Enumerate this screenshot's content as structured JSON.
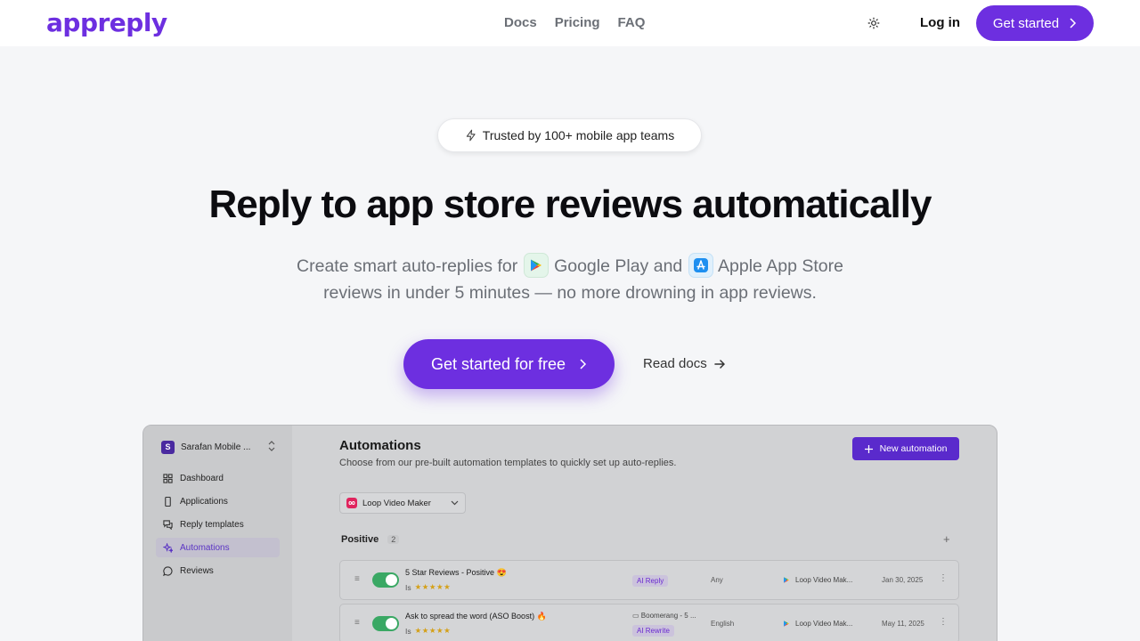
{
  "brand": {
    "logo": "appreply",
    "accent": "#6d2fe0"
  },
  "nav": {
    "links": [
      "Docs",
      "Pricing",
      "FAQ"
    ],
    "theme_icon": "sun-icon",
    "login": "Log in",
    "cta": "Get started"
  },
  "hero": {
    "badge": "Trusted by 100+ mobile app teams",
    "title": "Reply to app store reviews automatically",
    "sub_part1": "Create smart auto-replies for",
    "google_play": "Google Play",
    "and": "and",
    "apple_store": "Apple App Store",
    "sub_line2": "reviews in under 5 minutes — no more drowning in app reviews.",
    "cta": "Get started for free",
    "docs": "Read docs"
  },
  "preview": {
    "workspace": {
      "initial": "S",
      "name": "Sarafan Mobile ..."
    },
    "sidebar": [
      {
        "label": "Dashboard",
        "icon": "dashboard-icon"
      },
      {
        "label": "Applications",
        "icon": "phone-icon"
      },
      {
        "label": "Reply templates",
        "icon": "chat-icon"
      },
      {
        "label": "Automations",
        "icon": "sparkles-icon",
        "active": true
      },
      {
        "label": "Reviews",
        "icon": "message-icon"
      }
    ],
    "title": "Automations",
    "description": "Choose from our pre-built automation templates to quickly set up auto-replies.",
    "new_button": "New automation",
    "app_select": "Loop Video Maker",
    "section": {
      "label": "Positive",
      "count": "2"
    },
    "rows": [
      {
        "title": "5 Star Reviews - Positive 😍",
        "stars_prefix": "Is",
        "stars": "★★★★★",
        "tag": "AI Reply",
        "folder": "",
        "language": "Any",
        "app": "Loop Video Mak...",
        "date": "Jan 30, 2025",
        "enabled": true
      },
      {
        "title": "Ask to spread the word (ASO Boost) 🔥",
        "stars_prefix": "Is",
        "stars": "★★★★★",
        "tag": "AI Rewrite",
        "folder": "Boomerang - 5 ...",
        "language": "English",
        "app": "Loop Video Mak...",
        "date": "May 11, 2025",
        "enabled": true
      }
    ]
  }
}
